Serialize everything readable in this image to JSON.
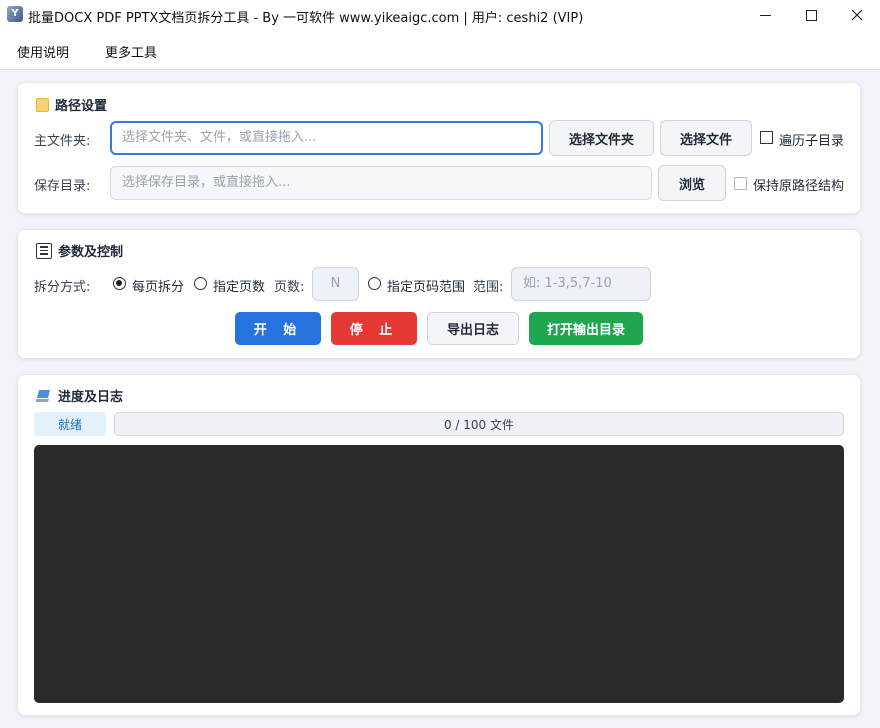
{
  "window": {
    "title": "批量DOCX PDF PPTX文档页拆分工具 - By 一可软件 www.yikeaigc.com  |  用户: ceshi2 (VIP)",
    "icon_name": "app-logo-icon"
  },
  "menu": {
    "usage": "使用说明",
    "tools": "更多工具"
  },
  "path_section": {
    "title": "路径设置",
    "main_folder_label": "主文件夹:",
    "main_folder_placeholder": "选择文件夹、文件，或直接拖入...",
    "choose_folder_label": "选择文件夹",
    "choose_file_label": "选择文件",
    "traverse_label": "遍历子目录",
    "traverse_checked": false,
    "save_dir_label": "保存目录:",
    "save_dir_placeholder": "选择保存目录，或直接拖入...",
    "browse_label": "浏览",
    "keep_structure_label": "保持原路径结构",
    "keep_structure_checked": false
  },
  "params_section": {
    "title": "参数及控制",
    "split_mode_label": "拆分方式:",
    "options": [
      {
        "label": "每页拆分",
        "checked": true
      },
      {
        "label": "指定页数",
        "checked": false
      },
      {
        "label": "指定页码范围",
        "checked": false
      }
    ],
    "pages_label": "页数:",
    "pages_value": "N",
    "range_label": "范围:",
    "range_placeholder": "如: 1-3,5,7-10",
    "start_label": "开 始",
    "stop_label": "停 止",
    "export_log_label": "导出日志",
    "open_output_label": "打开输出目录"
  },
  "log_section": {
    "title": "进度及日志",
    "status": "就绪",
    "progress_text": "0 / 100 文件",
    "progress_fraction": 0,
    "colors": {
      "log_background": "#2a2a2a",
      "start": "#2673dd",
      "stop": "#e53935",
      "open": "#1fa651"
    }
  }
}
